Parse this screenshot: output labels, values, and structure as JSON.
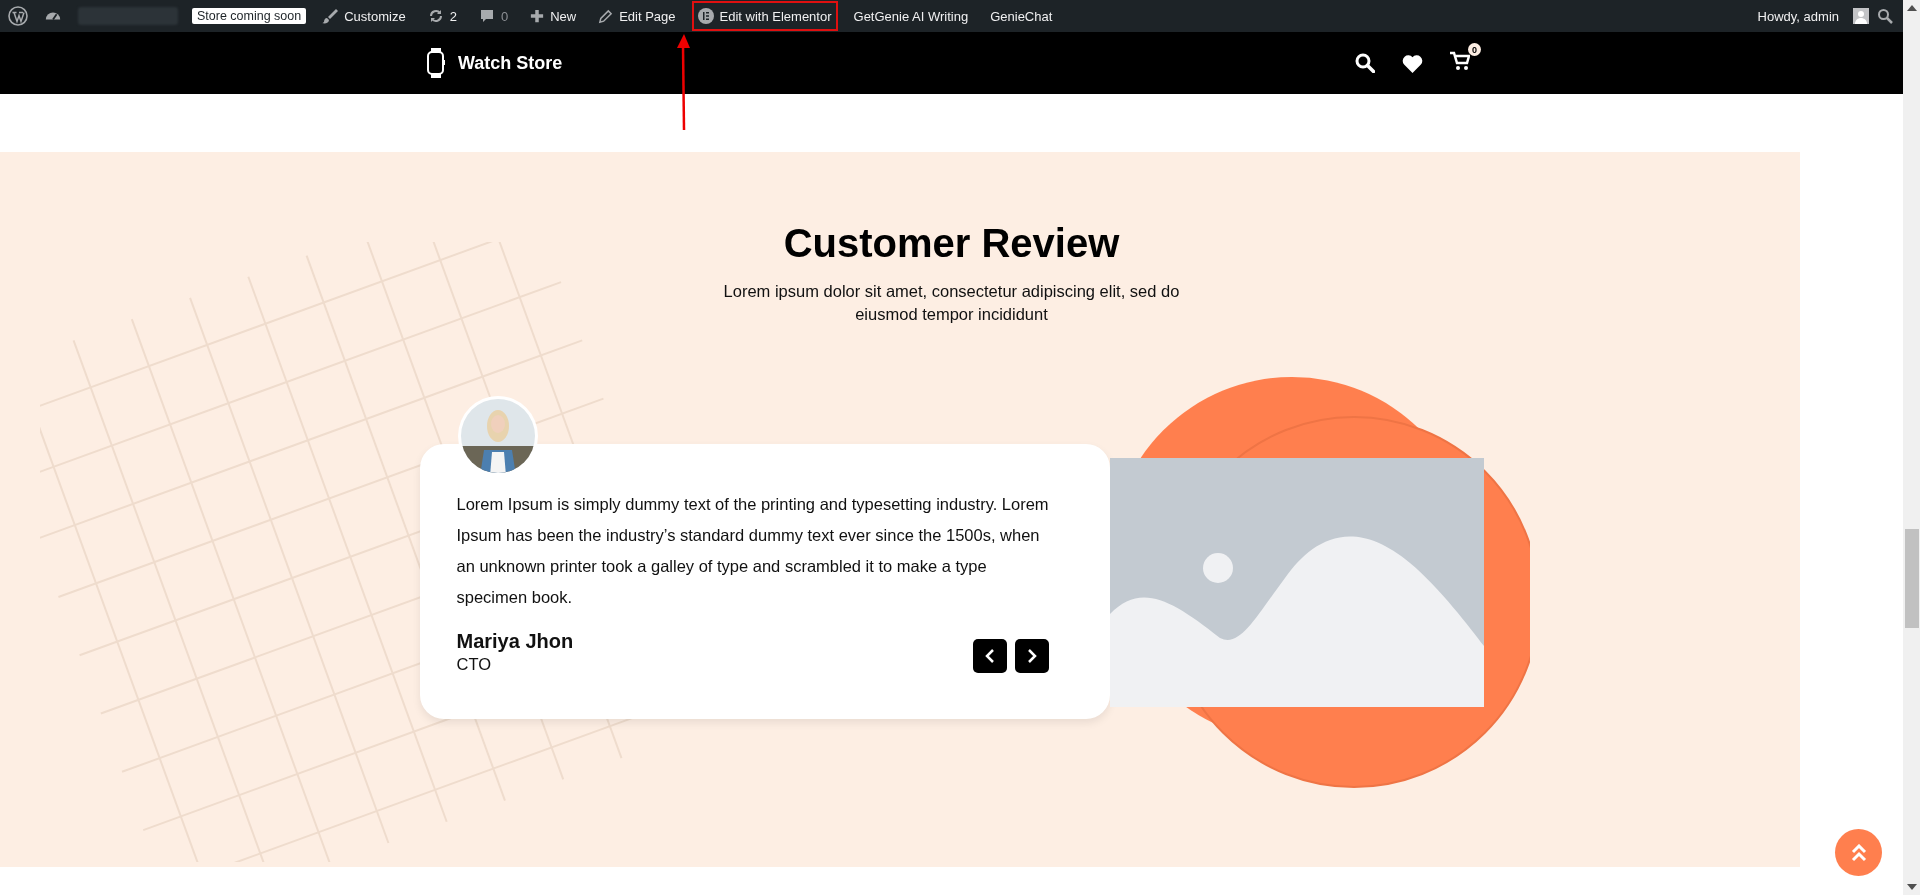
{
  "admin_bar": {
    "badge": "Store coming soon",
    "items": [
      {
        "kind": "customize",
        "label": "Customize",
        "highlighted": false
      },
      {
        "kind": "updates",
        "label": "2",
        "highlighted": false
      },
      {
        "kind": "comments",
        "label": "0",
        "highlighted": false
      },
      {
        "kind": "new",
        "label": "New",
        "highlighted": false
      },
      {
        "kind": "edit",
        "label": "Edit Page",
        "highlighted": false
      },
      {
        "kind": "elementor",
        "label": "Edit with Elementor",
        "highlighted": true
      },
      {
        "kind": "text",
        "label": "GetGenie AI Writing",
        "highlighted": false
      },
      {
        "kind": "text",
        "label": "GenieChat",
        "highlighted": false
      }
    ],
    "greeting": "Howdy, admin"
  },
  "header": {
    "brand": "Watch Store",
    "cart_count": "0"
  },
  "section": {
    "title": "Customer Review",
    "subtitle": "Lorem ipsum dolor sit amet, consectetur adipiscing elit, sed do eiusmod tempor incididunt",
    "review": {
      "text": "Lorem Ipsum is simply dummy text of the printing and typesetting industry. Lorem Ipsum has been the industry’s standard dummy text ever since the 1500s, when an unknown printer took a galley of type and scrambled it to make a type specimen book.",
      "name": "Mariya Jhon",
      "role": "CTO"
    }
  }
}
